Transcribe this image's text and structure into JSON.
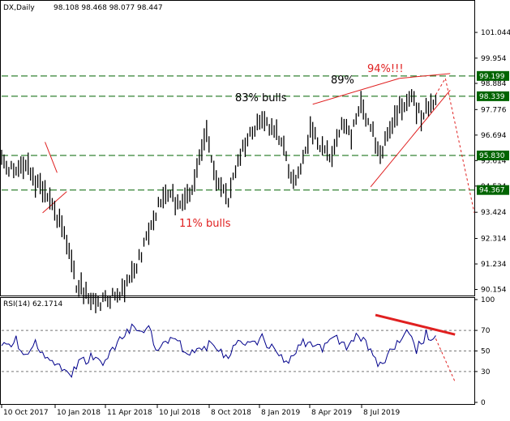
{
  "header": {
    "symbol": "DX,Daily",
    "ohlc": "98.108 98.468 98.077 98.447"
  },
  "rsi_header": {
    "label": "RSI(14) 62.1714"
  },
  "colors": {
    "background": "#ffffff",
    "candle": "#000000",
    "level_line": "#006400",
    "level_box": "#006400",
    "level_text": "#ffffff",
    "annotation_red": "#e02020",
    "rsi_line": "#00008b",
    "rsi_trend": "#e02020"
  },
  "annotations": {
    "bulls_11": "11% bulls",
    "bulls_83": "83% bulls",
    "pct_89": "89%",
    "pct_94": "94%!!!"
  },
  "chart_data": [
    {
      "type": "line",
      "name": "price",
      "title": "DX,Daily",
      "y_ticks": [
        "101.044",
        "99.954",
        "98.884",
        "97.776",
        "96.694",
        "95.614",
        "94.534",
        "93.424",
        "92.314",
        "91.234",
        "90.154"
      ],
      "ylim": [
        90.0,
        101.8
      ],
      "x_tick_labels": [
        "10 Oct 2017",
        "10 Jan 2018",
        "11 Apr 2018",
        "10 Jul 2018",
        "8 Oct 2018",
        "8 Jan 2019",
        "8 Apr 2019",
        "8 Jul 2019"
      ],
      "levels": [
        {
          "label": "99.199",
          "value": 99.199
        },
        {
          "label": "98.339",
          "value": 98.339
        },
        {
          "label": "95.830",
          "value": 95.83
        },
        {
          "label": "94.367",
          "value": 94.367
        }
      ],
      "trend_points": [
        {
          "x": 0,
          "y": 95.6
        },
        {
          "x": 6,
          "y": 95.0
        },
        {
          "x": 10,
          "y": 95.4
        },
        {
          "x": 16,
          "y": 94.4
        },
        {
          "x": 21,
          "y": 93.6
        },
        {
          "x": 25,
          "y": 92.8
        },
        {
          "x": 28,
          "y": 91.6
        },
        {
          "x": 31,
          "y": 90.4
        },
        {
          "x": 36,
          "y": 89.8
        },
        {
          "x": 41,
          "y": 89.6
        },
        {
          "x": 47,
          "y": 89.9
        },
        {
          "x": 52,
          "y": 90.4
        },
        {
          "x": 58,
          "y": 91.6
        },
        {
          "x": 63,
          "y": 93.2
        },
        {
          "x": 68,
          "y": 94.3
        },
        {
          "x": 73,
          "y": 93.8
        },
        {
          "x": 78,
          "y": 94.2
        },
        {
          "x": 81,
          "y": 95.4
        },
        {
          "x": 85,
          "y": 96.8
        },
        {
          "x": 88,
          "y": 95.0
        },
        {
          "x": 94,
          "y": 94.0
        },
        {
          "x": 98,
          "y": 95.6
        },
        {
          "x": 103,
          "y": 96.6
        },
        {
          "x": 108,
          "y": 97.3
        },
        {
          "x": 112,
          "y": 97.1
        },
        {
          "x": 117,
          "y": 96.2
        },
        {
          "x": 121,
          "y": 94.6
        },
        {
          "x": 125,
          "y": 95.8
        },
        {
          "x": 128,
          "y": 96.9
        },
        {
          "x": 133,
          "y": 96.0
        },
        {
          "x": 137,
          "y": 95.8
        },
        {
          "x": 141,
          "y": 97.0
        },
        {
          "x": 145,
          "y": 96.7
        },
        {
          "x": 149,
          "y": 97.9
        },
        {
          "x": 153,
          "y": 97.0
        },
        {
          "x": 157,
          "y": 96.0
        },
        {
          "x": 161,
          "y": 96.7
        },
        {
          "x": 165,
          "y": 97.9
        },
        {
          "x": 170,
          "y": 98.3
        },
        {
          "x": 174,
          "y": 97.4
        },
        {
          "x": 178,
          "y": 98.0
        },
        {
          "x": 180,
          "y": 98.4
        }
      ],
      "projection": [
        {
          "x": 180,
          "y": 98.4
        },
        {
          "x": 184,
          "y": 99.1
        },
        {
          "x": 196,
          "y": 93.4
        }
      ],
      "annotation_lines": [
        {
          "from": {
            "x": 17,
            "y": 93.4
          },
          "to": {
            "x": 27,
            "y": 94.3
          }
        },
        {
          "from": {
            "x": 18,
            "y": 96.4
          },
          "to": {
            "x": 23,
            "y": 95.1
          }
        },
        {
          "from": {
            "x": 129,
            "y": 98.0
          },
          "to": {
            "x": 165,
            "y": 99.1
          }
        },
        {
          "from": {
            "x": 165,
            "y": 99.1
          },
          "to": {
            "x": 186,
            "y": 99.3
          }
        },
        {
          "from": {
            "x": 153,
            "y": 94.5
          },
          "to": {
            "x": 186,
            "y": 98.6
          }
        }
      ]
    },
    {
      "type": "line",
      "name": "rsi",
      "title": "RSI(14) 62.1714",
      "y_ticks": [
        "100",
        "70",
        "50",
        "30",
        "0"
      ],
      "ylim": [
        0,
        100
      ],
      "levels": [
        70,
        50,
        30
      ],
      "trend_points": [
        {
          "x": 0,
          "y": 55
        },
        {
          "x": 6,
          "y": 60
        },
        {
          "x": 10,
          "y": 48
        },
        {
          "x": 14,
          "y": 58
        },
        {
          "x": 19,
          "y": 40
        },
        {
          "x": 24,
          "y": 35
        },
        {
          "x": 29,
          "y": 28
        },
        {
          "x": 33,
          "y": 40
        },
        {
          "x": 38,
          "y": 45
        },
        {
          "x": 42,
          "y": 38
        },
        {
          "x": 47,
          "y": 55
        },
        {
          "x": 52,
          "y": 70
        },
        {
          "x": 55,
          "y": 74
        },
        {
          "x": 58,
          "y": 65
        },
        {
          "x": 61,
          "y": 75
        },
        {
          "x": 64,
          "y": 52
        },
        {
          "x": 70,
          "y": 62
        },
        {
          "x": 76,
          "y": 52
        },
        {
          "x": 82,
          "y": 48
        },
        {
          "x": 87,
          "y": 60
        },
        {
          "x": 93,
          "y": 42
        },
        {
          "x": 98,
          "y": 60
        },
        {
          "x": 103,
          "y": 55
        },
        {
          "x": 108,
          "y": 62
        },
        {
          "x": 113,
          "y": 52
        },
        {
          "x": 118,
          "y": 38
        },
        {
          "x": 123,
          "y": 55
        },
        {
          "x": 128,
          "y": 60
        },
        {
          "x": 133,
          "y": 50
        },
        {
          "x": 138,
          "y": 62
        },
        {
          "x": 143,
          "y": 55
        },
        {
          "x": 148,
          "y": 66
        },
        {
          "x": 152,
          "y": 55
        },
        {
          "x": 156,
          "y": 35
        },
        {
          "x": 160,
          "y": 45
        },
        {
          "x": 164,
          "y": 60
        },
        {
          "x": 168,
          "y": 70
        },
        {
          "x": 172,
          "y": 52
        },
        {
          "x": 176,
          "y": 66
        },
        {
          "x": 180,
          "y": 62
        }
      ],
      "projection": [
        {
          "x": 180,
          "y": 62
        },
        {
          "x": 188,
          "y": 20
        }
      ],
      "annotation_lines": [
        {
          "from": {
            "x": 155,
            "y": 85
          },
          "to": {
            "x": 188,
            "y": 66
          }
        }
      ]
    }
  ]
}
